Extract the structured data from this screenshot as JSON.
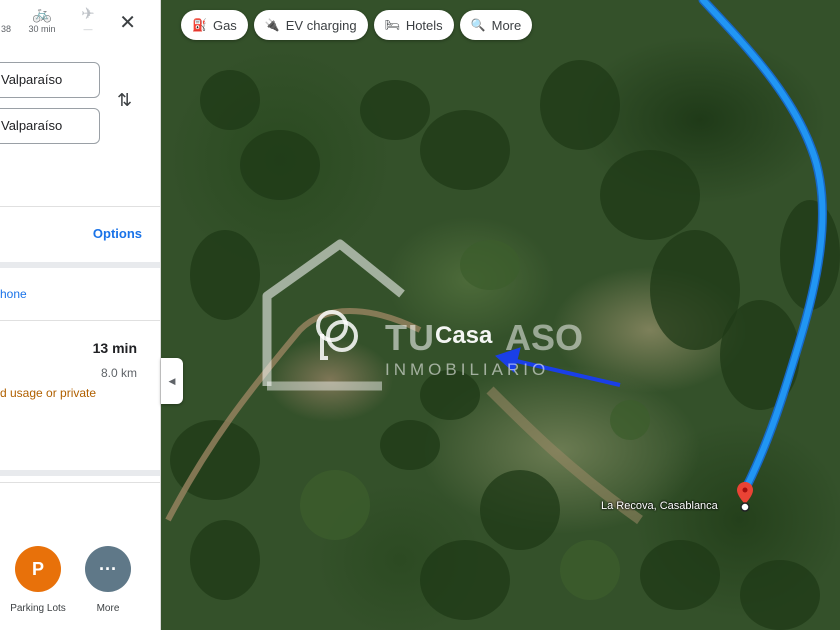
{
  "travel_modes": [
    {
      "icon": "car-icon",
      "time": "38"
    },
    {
      "icon": "bicycle-icon",
      "time": "30 min"
    },
    {
      "icon": "airplane-icon",
      "time": "—"
    }
  ],
  "directions": {
    "origin": "Valparaíso",
    "destination": "Valparaíso",
    "options_label": "Options",
    "phone_label": "hone"
  },
  "route": {
    "duration": "13 min",
    "distance": "8.0 km",
    "warning": "d usage or private"
  },
  "nearby": [
    {
      "icon": "parking-icon",
      "glyph": "P",
      "label": "Parking Lots",
      "color": "#e8710a"
    },
    {
      "icon": "more-icon",
      "glyph": "···",
      "label": "More",
      "color": "#5f7888"
    }
  ],
  "chips": [
    {
      "icon": "gas-icon",
      "label": "Gas"
    },
    {
      "icon": "ev-charging-icon",
      "label": "EV charging"
    },
    {
      "icon": "hotel-icon",
      "label": "Hotels"
    },
    {
      "icon": "search-icon",
      "label": "More"
    }
  ],
  "map": {
    "destination_label": "La Recova, Casablanca",
    "route_color": "#2196f3",
    "arrow_color": "#1a3fe8"
  },
  "watermark": {
    "tu": "TU",
    "casa": "Casa",
    "aso": "ASO",
    "sub": "INMOBILIARIO"
  }
}
